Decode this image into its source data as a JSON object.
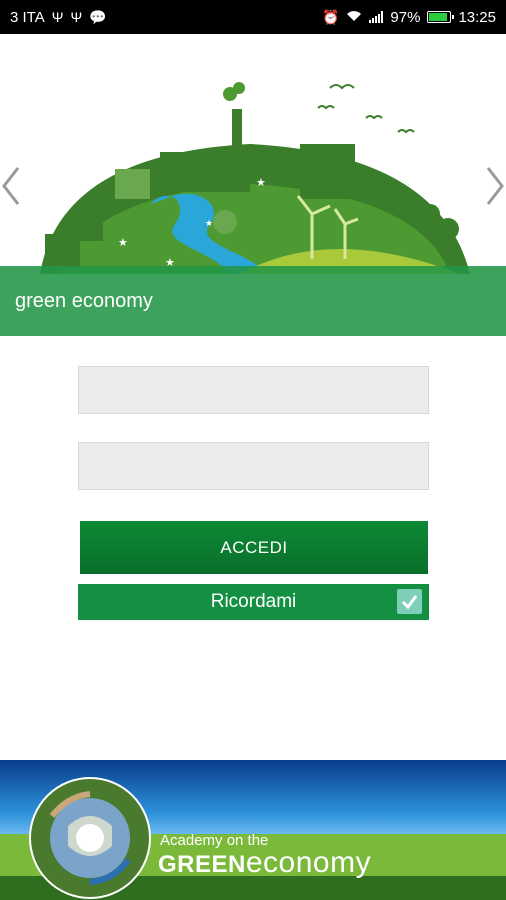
{
  "status_bar": {
    "carrier": "3 ITA",
    "battery": "97%",
    "battery_level": 0.97,
    "time": "13:25",
    "icons": [
      "usb-icon",
      "usb-icon",
      "message-icon",
      "alarm-icon",
      "wifi-icon",
      "signal-icon",
      "battery-icon"
    ]
  },
  "banner": {
    "title": "green economy",
    "prev_icon": "chevron-left-icon",
    "next_icon": "chevron-right-icon",
    "illustration": "green-city-globe-illustration"
  },
  "login": {
    "username_placeholder": "",
    "password_placeholder": "",
    "submit_label": "ACCEDI",
    "remember_label": "Ricordami",
    "remember_checked": true
  },
  "footer": {
    "logo_line1": "Academy on the",
    "logo_green": "GREEN",
    "logo_eco": "economy"
  },
  "colors": {
    "primary_green": "#0c8a35",
    "band_green": "#229646",
    "checkbox": "#7fcfb8"
  }
}
